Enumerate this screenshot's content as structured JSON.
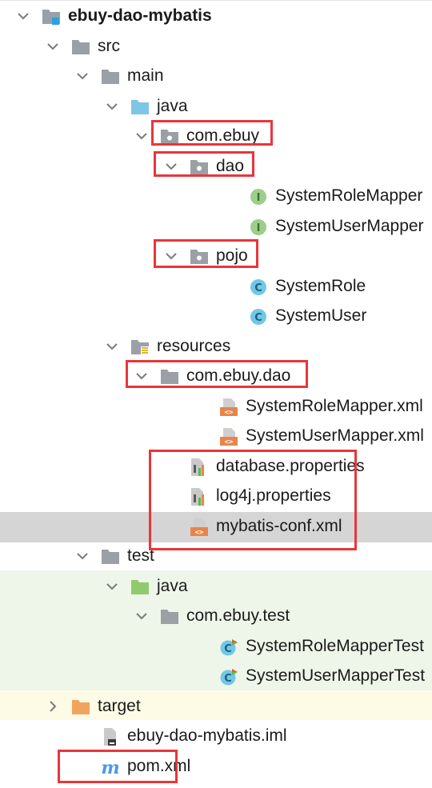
{
  "project": {
    "name": "ebuy-dao-mybatis"
  },
  "tree": {
    "src": "src",
    "main": "main",
    "main_java": "java",
    "pkg_com_ebuy": "com.ebuy",
    "pkg_dao": "dao",
    "file_system_role_mapper": "SystemRoleMapper",
    "file_system_user_mapper": "SystemUserMapper",
    "pkg_pojo": "pojo",
    "file_system_role": "SystemRole",
    "file_system_user": "SystemUser",
    "resources": "resources",
    "pkg_com_ebuy_dao": "com.ebuy.dao",
    "file_system_role_mapper_xml": "SystemRoleMapper.xml",
    "file_system_user_mapper_xml": "SystemUserMapper.xml",
    "file_database_properties": "database.properties",
    "file_log4j_properties": "log4j.properties",
    "file_mybatis_conf_xml": "mybatis-conf.xml",
    "test": "test",
    "test_java": "java",
    "pkg_com_ebuy_test": "com.ebuy.test",
    "file_system_role_mapper_test": "SystemRoleMapperTest",
    "file_system_user_mapper_test": "SystemUserMapperTest",
    "target": "target",
    "file_iml": "ebuy-dao-mybatis.iml",
    "file_pom": "pom.xml"
  },
  "colors": {
    "highlight_box": "#e8363b",
    "selected_row": "#d5d5d5",
    "test_bg": "#eef6e9",
    "excluded_bg": "#fdfbe6",
    "interface_icon": "#9dce8a",
    "class_icon": "#71c8e6",
    "folder_grey": "#9aa0a6",
    "source_root": "#7dc6e8",
    "test_root": "#8fca6e",
    "target_folder": "#f0a45d",
    "maven_blue": "#4a9ae6"
  },
  "icons": {
    "expanded": "chevron-down-icon",
    "collapsed": "chevron-right-icon",
    "module": "module-folder-icon",
    "folder": "folder-icon",
    "source_root": "source-root-folder-icon",
    "package": "package-icon",
    "resources": "resources-folder-icon",
    "interface": "interface-icon",
    "class": "class-icon",
    "xml": "xml-file-icon",
    "properties": "properties-file-icon",
    "test_root": "test-root-folder-icon",
    "test_class": "test-class-icon",
    "target": "target-folder-icon",
    "iml": "iml-file-icon",
    "maven": "maven-icon"
  },
  "state": {
    "selected": "mybatis-conf.xml"
  }
}
